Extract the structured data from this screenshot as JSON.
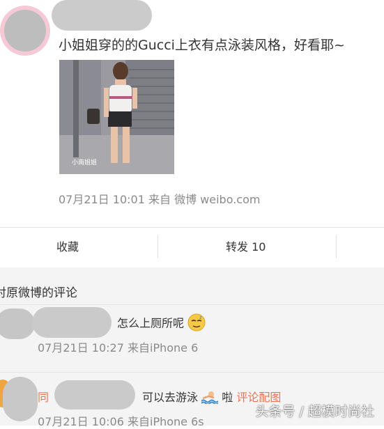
{
  "post": {
    "text": "小姐姐穿的的Gucci上衣有点泳装风格，好看耶~",
    "meta": "07月21日 10:01 来自 微博 weibo.com",
    "photo_watermark": "小南姐姐"
  },
  "actions": {
    "favorite": "收藏",
    "repost": "转发 10"
  },
  "comments_section": {
    "title": "对原微博的评论",
    "comments": [
      {
        "text": "怎么上厕所呢",
        "emoji": "sleepy-face-icon",
        "meta": "07月21日 10:27 来自iPhone 6"
      },
      {
        "prefix": "同",
        "text": "可以去游泳",
        "emoji": "swimmer-icon",
        "text_after": "啦",
        "link": "评论配图",
        "meta": "07月21日 10:06 来自iPhone 6s"
      }
    ]
  },
  "watermark": "头条号 / 超模时尚社",
  "colors": {
    "link": "#eb7350",
    "meta": "#8a8a8a",
    "section_bg": "#f4f4f4"
  }
}
